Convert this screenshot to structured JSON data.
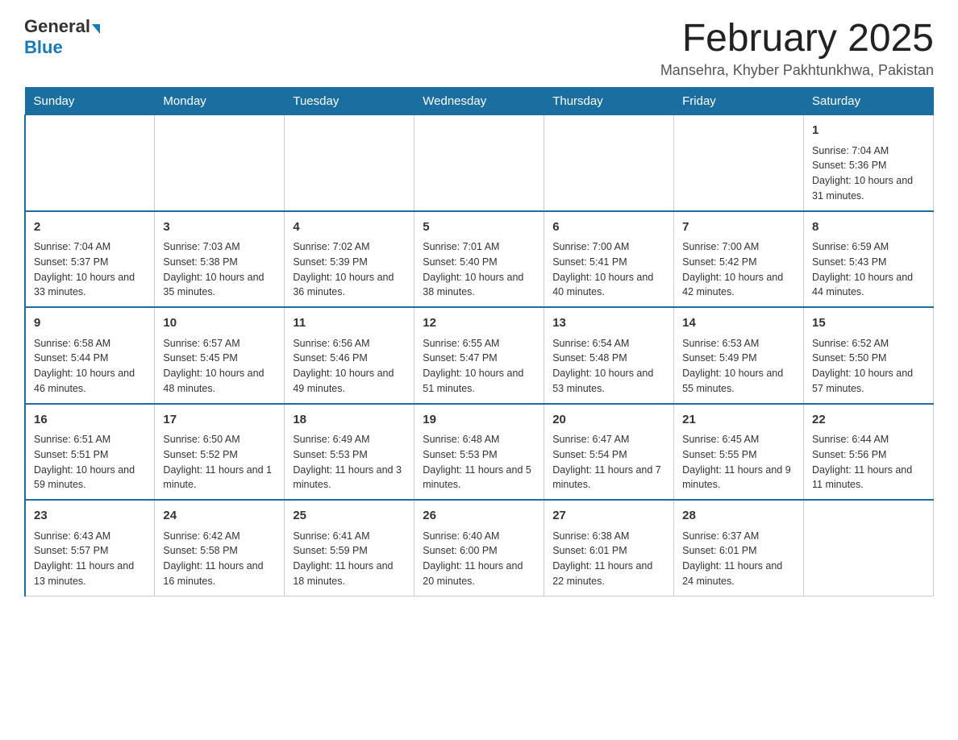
{
  "logo": {
    "general": "General",
    "blue": "Blue"
  },
  "title": "February 2025",
  "location": "Mansehra, Khyber Pakhtunkhwa, Pakistan",
  "days_of_week": [
    "Sunday",
    "Monday",
    "Tuesday",
    "Wednesday",
    "Thursday",
    "Friday",
    "Saturday"
  ],
  "weeks": [
    [
      {
        "day": "",
        "info": ""
      },
      {
        "day": "",
        "info": ""
      },
      {
        "day": "",
        "info": ""
      },
      {
        "day": "",
        "info": ""
      },
      {
        "day": "",
        "info": ""
      },
      {
        "day": "",
        "info": ""
      },
      {
        "day": "1",
        "info": "Sunrise: 7:04 AM\nSunset: 5:36 PM\nDaylight: 10 hours and 31 minutes."
      }
    ],
    [
      {
        "day": "2",
        "info": "Sunrise: 7:04 AM\nSunset: 5:37 PM\nDaylight: 10 hours and 33 minutes."
      },
      {
        "day": "3",
        "info": "Sunrise: 7:03 AM\nSunset: 5:38 PM\nDaylight: 10 hours and 35 minutes."
      },
      {
        "day": "4",
        "info": "Sunrise: 7:02 AM\nSunset: 5:39 PM\nDaylight: 10 hours and 36 minutes."
      },
      {
        "day": "5",
        "info": "Sunrise: 7:01 AM\nSunset: 5:40 PM\nDaylight: 10 hours and 38 minutes."
      },
      {
        "day": "6",
        "info": "Sunrise: 7:00 AM\nSunset: 5:41 PM\nDaylight: 10 hours and 40 minutes."
      },
      {
        "day": "7",
        "info": "Sunrise: 7:00 AM\nSunset: 5:42 PM\nDaylight: 10 hours and 42 minutes."
      },
      {
        "day": "8",
        "info": "Sunrise: 6:59 AM\nSunset: 5:43 PM\nDaylight: 10 hours and 44 minutes."
      }
    ],
    [
      {
        "day": "9",
        "info": "Sunrise: 6:58 AM\nSunset: 5:44 PM\nDaylight: 10 hours and 46 minutes."
      },
      {
        "day": "10",
        "info": "Sunrise: 6:57 AM\nSunset: 5:45 PM\nDaylight: 10 hours and 48 minutes."
      },
      {
        "day": "11",
        "info": "Sunrise: 6:56 AM\nSunset: 5:46 PM\nDaylight: 10 hours and 49 minutes."
      },
      {
        "day": "12",
        "info": "Sunrise: 6:55 AM\nSunset: 5:47 PM\nDaylight: 10 hours and 51 minutes."
      },
      {
        "day": "13",
        "info": "Sunrise: 6:54 AM\nSunset: 5:48 PM\nDaylight: 10 hours and 53 minutes."
      },
      {
        "day": "14",
        "info": "Sunrise: 6:53 AM\nSunset: 5:49 PM\nDaylight: 10 hours and 55 minutes."
      },
      {
        "day": "15",
        "info": "Sunrise: 6:52 AM\nSunset: 5:50 PM\nDaylight: 10 hours and 57 minutes."
      }
    ],
    [
      {
        "day": "16",
        "info": "Sunrise: 6:51 AM\nSunset: 5:51 PM\nDaylight: 10 hours and 59 minutes."
      },
      {
        "day": "17",
        "info": "Sunrise: 6:50 AM\nSunset: 5:52 PM\nDaylight: 11 hours and 1 minute."
      },
      {
        "day": "18",
        "info": "Sunrise: 6:49 AM\nSunset: 5:53 PM\nDaylight: 11 hours and 3 minutes."
      },
      {
        "day": "19",
        "info": "Sunrise: 6:48 AM\nSunset: 5:53 PM\nDaylight: 11 hours and 5 minutes."
      },
      {
        "day": "20",
        "info": "Sunrise: 6:47 AM\nSunset: 5:54 PM\nDaylight: 11 hours and 7 minutes."
      },
      {
        "day": "21",
        "info": "Sunrise: 6:45 AM\nSunset: 5:55 PM\nDaylight: 11 hours and 9 minutes."
      },
      {
        "day": "22",
        "info": "Sunrise: 6:44 AM\nSunset: 5:56 PM\nDaylight: 11 hours and 11 minutes."
      }
    ],
    [
      {
        "day": "23",
        "info": "Sunrise: 6:43 AM\nSunset: 5:57 PM\nDaylight: 11 hours and 13 minutes."
      },
      {
        "day": "24",
        "info": "Sunrise: 6:42 AM\nSunset: 5:58 PM\nDaylight: 11 hours and 16 minutes."
      },
      {
        "day": "25",
        "info": "Sunrise: 6:41 AM\nSunset: 5:59 PM\nDaylight: 11 hours and 18 minutes."
      },
      {
        "day": "26",
        "info": "Sunrise: 6:40 AM\nSunset: 6:00 PM\nDaylight: 11 hours and 20 minutes."
      },
      {
        "day": "27",
        "info": "Sunrise: 6:38 AM\nSunset: 6:01 PM\nDaylight: 11 hours and 22 minutes."
      },
      {
        "day": "28",
        "info": "Sunrise: 6:37 AM\nSunset: 6:01 PM\nDaylight: 11 hours and 24 minutes."
      },
      {
        "day": "",
        "info": ""
      }
    ]
  ]
}
